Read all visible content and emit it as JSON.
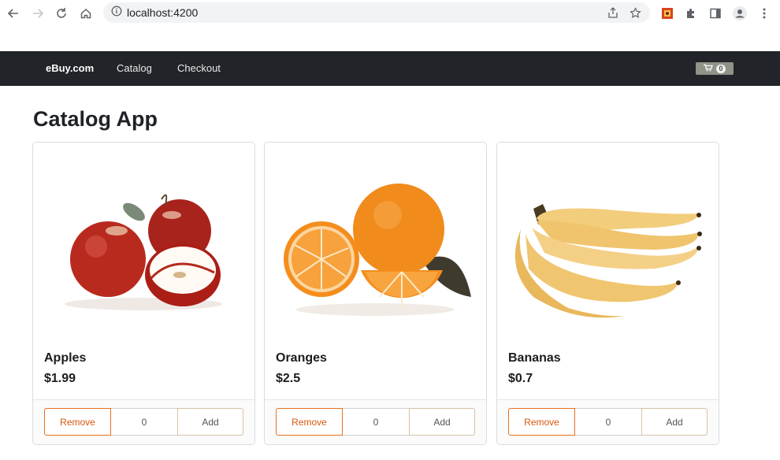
{
  "browser": {
    "url": "localhost:4200"
  },
  "navbar": {
    "brand": "eBuy.com",
    "links": [
      "Catalog",
      "Checkout"
    ],
    "cart_count": "0"
  },
  "page": {
    "title": "Catalog App"
  },
  "products": [
    {
      "name": "Apples",
      "price": "$1.99",
      "quantity": "0",
      "remove_label": "Remove",
      "add_label": "Add",
      "image": "apples-image"
    },
    {
      "name": "Oranges",
      "price": "$2.5",
      "quantity": "0",
      "remove_label": "Remove",
      "add_label": "Add",
      "image": "oranges-image"
    },
    {
      "name": "Bananas",
      "price": "$0.7",
      "quantity": "0",
      "remove_label": "Remove",
      "add_label": "Add",
      "image": "bananas-image"
    }
  ],
  "colors": {
    "navbar_bg": "#212529",
    "remove_accent": "#e8711c"
  }
}
